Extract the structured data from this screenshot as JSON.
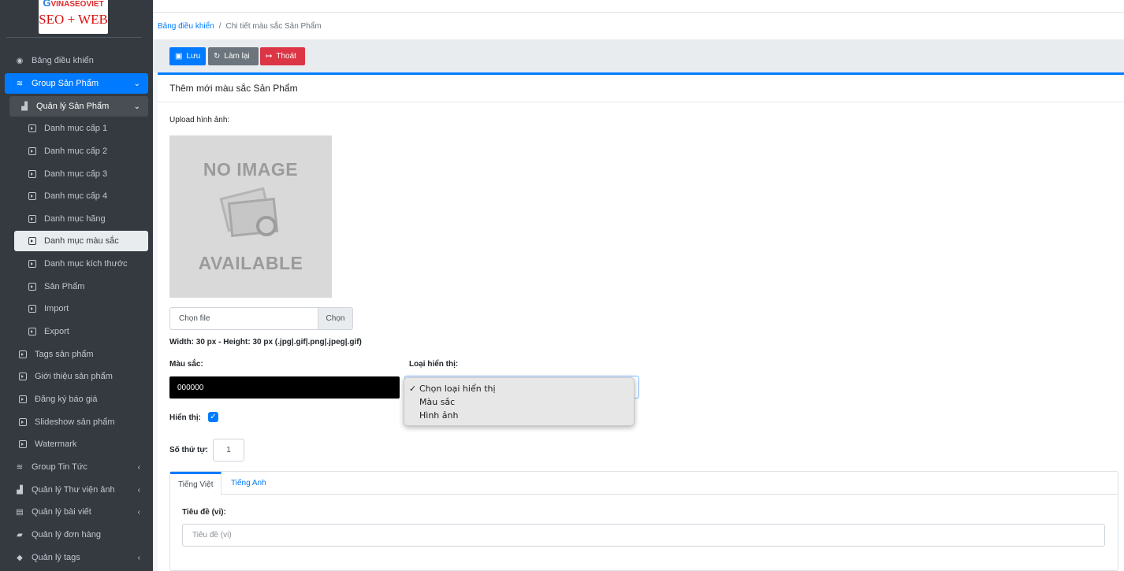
{
  "logo": {
    "top_text": "VINASEOVIET",
    "bottom_text": "SEO + WEB"
  },
  "sidebar": {
    "items": [
      {
        "label": "Bảng điều khiển",
        "icon": "dashboard-icon"
      },
      {
        "label": "Group Sản Phẩm",
        "icon": "layers-icon"
      },
      {
        "label": "Quản lý Sản Phẩm",
        "icon": "boxes-icon"
      },
      {
        "label": "Danh mục cấp 1",
        "icon": "play-square-icon"
      },
      {
        "label": "Danh mục cấp 2",
        "icon": "play-square-icon"
      },
      {
        "label": "Danh mục cấp 3",
        "icon": "play-square-icon"
      },
      {
        "label": "Danh mục cấp 4",
        "icon": "play-square-icon"
      },
      {
        "label": "Danh mục hãng",
        "icon": "play-square-icon"
      },
      {
        "label": "Danh mục màu sắc",
        "icon": "play-square-icon"
      },
      {
        "label": "Danh mục kích thước",
        "icon": "play-square-icon"
      },
      {
        "label": "Sản Phẩm",
        "icon": "play-square-icon"
      },
      {
        "label": "Import",
        "icon": "play-square-icon"
      },
      {
        "label": "Export",
        "icon": "play-square-icon"
      },
      {
        "label": "Tags sản phẩm",
        "icon": "play-square-icon"
      },
      {
        "label": "Giới thiệu sản phẩm",
        "icon": "play-square-icon"
      },
      {
        "label": "Đăng ký báo giá",
        "icon": "play-square-icon"
      },
      {
        "label": "Slideshow sản phẩm",
        "icon": "play-square-icon"
      },
      {
        "label": "Watermark",
        "icon": "play-square-icon"
      },
      {
        "label": "Group Tin Tức",
        "icon": "layers-icon"
      },
      {
        "label": "Quản lý Thư viện ảnh",
        "icon": "boxes-icon"
      },
      {
        "label": "Quản lý bài viết",
        "icon": "newspaper-icon"
      },
      {
        "label": "Quản lý đơn hàng",
        "icon": "shopping-bag-icon"
      },
      {
        "label": "Quản lý tags",
        "icon": "tags-icon"
      }
    ]
  },
  "breadcrumb": {
    "home": "Bảng điều khiển",
    "current": "Chi tiết màu sắc Sản Phẩm"
  },
  "toolbar": {
    "save": "Lưu",
    "reset": "Làm lại",
    "exit": "Thoát"
  },
  "form": {
    "card_title": "Thêm mới màu sắc Sản Phẩm",
    "upload_label": "Upload hình ảnh:",
    "noimage_top": "NO IMAGE",
    "noimage_bottom": "AVAILABLE",
    "file_placeholder": "Chọn file",
    "file_button": "Chọn",
    "size_hint": "Width: 30 px - Height: 30 px (.jpg|.gif|.png|.jpeg|.gif)",
    "color_label": "Màu sắc:",
    "color_value": "000000",
    "display_type_label": "Loại hiển thị:",
    "display_type_options": [
      "Chọn loại hiển thị",
      "Màu sắc",
      "Hình ảnh"
    ],
    "display_type_selected": "Chọn loại hiển thị",
    "visible_label": "Hiển thị:",
    "visible_checked": true,
    "order_label": "Số thứ tự:",
    "order_value": "1",
    "tabs": [
      "Tiếng Việt",
      "Tiếng Anh"
    ],
    "title_label": "Tiêu đề (vi):",
    "title_placeholder": "Tiêu đề (vi)"
  },
  "colors": {
    "primary": "#007bff",
    "secondary": "#6c757d",
    "danger": "#dc3545",
    "sidebar": "#343a40"
  }
}
